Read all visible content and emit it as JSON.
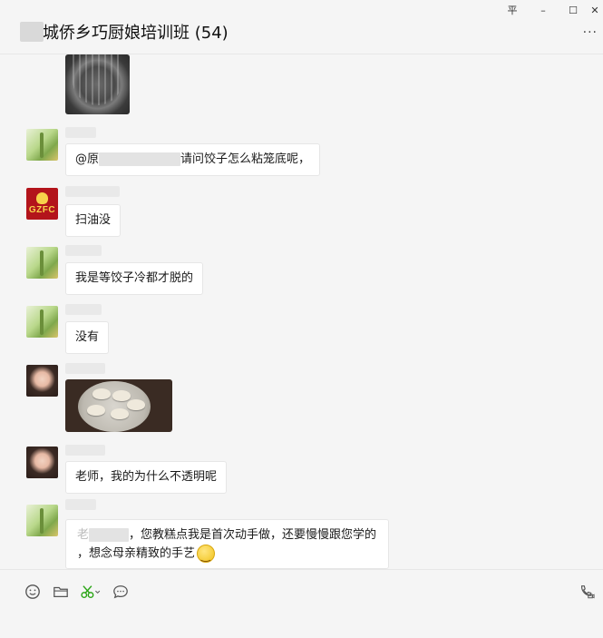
{
  "window": {
    "title": "城侨乡巧厨娘培训班 (54)",
    "pin_label": "平",
    "minimize_label": "–",
    "maximize_label": "☐",
    "close_label": "✕",
    "more_label": "···"
  },
  "messages": [
    {
      "type": "image",
      "content": "steamer basket photo"
    },
    {
      "type": "text",
      "avatar": "plant-avatar",
      "prefix": "@原",
      "text": "请问饺子怎么粘笼底呢，"
    },
    {
      "type": "text",
      "avatar": "gzfc-avatar",
      "avatar_text": "GZFC",
      "text": "扫油没"
    },
    {
      "type": "text",
      "avatar": "plant-avatar",
      "text": "我是等饺子冷都才脱的"
    },
    {
      "type": "text",
      "avatar": "plant-avatar",
      "text": "没有"
    },
    {
      "type": "image",
      "avatar": "woman-avatar",
      "content": "dumplings on plate photo"
    },
    {
      "type": "text",
      "avatar": "woman-avatar",
      "text": "老师，我的为什么不透明呢"
    },
    {
      "type": "text",
      "avatar": "plant-avatar",
      "prefix": "老",
      "line1": "，您教糕点我是首次动手做，还要慢慢跟您学的",
      "line2": "，想念母亲精致的手艺"
    }
  ],
  "toolbar": {
    "icons": [
      "emoji-icon",
      "folder-icon",
      "scissors-icon",
      "chat-bubble-icon",
      "phone-video-icon"
    ],
    "accent": "#2aa515"
  }
}
